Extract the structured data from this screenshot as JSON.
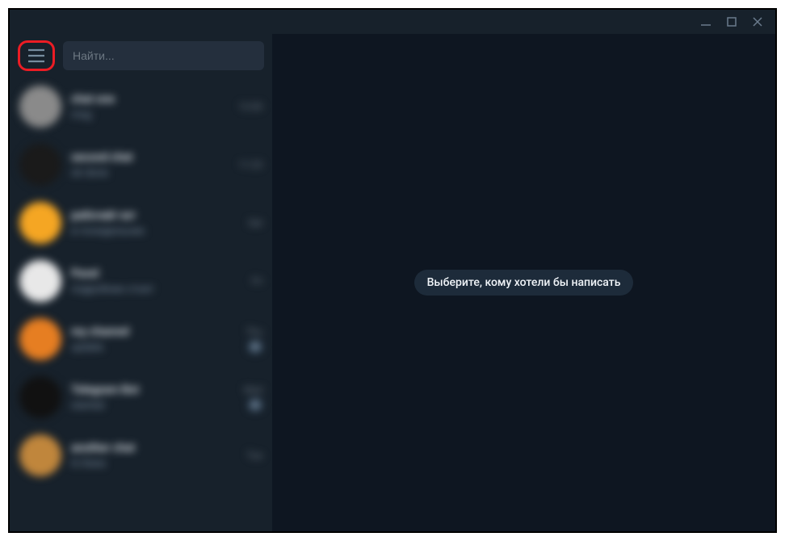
{
  "window": {
    "search_placeholder": "Найти...",
    "empty_message": "Выберите, кому хотели бы написать"
  },
  "chats": [
    {
      "name": "chat one",
      "preview": "msg",
      "time": "12:00",
      "avatar_bg": "#8a8a8a",
      "preview_accent": false,
      "badge": ""
    },
    {
      "name": "second chat",
      "preview": "ok done",
      "time": "11:23",
      "avatar_bg": "#1a1a1a",
      "preview_accent": false,
      "badge": ""
    },
    {
      "name": "рабочий чат",
      "preview": "в понедельник",
      "time": "Sat",
      "avatar_bg": "#f5a623",
      "preview_accent": true,
      "badge": ""
    },
    {
      "name": "Pavel",
      "preview": "подробнее стоит",
      "time": "Fri",
      "avatar_bg": "#e8e8e8",
      "preview_accent": false,
      "badge": ""
    },
    {
      "name": "my channel",
      "preview": "update",
      "time": "Thu",
      "avatar_bg": "#e67e22",
      "preview_accent": true,
      "badge": "3"
    },
    {
      "name": "Telegram Bot",
      "preview": "started",
      "time": "Wed",
      "avatar_bg": "#111111",
      "preview_accent": true,
      "badge": "2"
    },
    {
      "name": "another chat",
      "preview": "hi there",
      "time": "Tue",
      "avatar_bg": "#c0863c",
      "preview_accent": false,
      "badge": ""
    }
  ]
}
